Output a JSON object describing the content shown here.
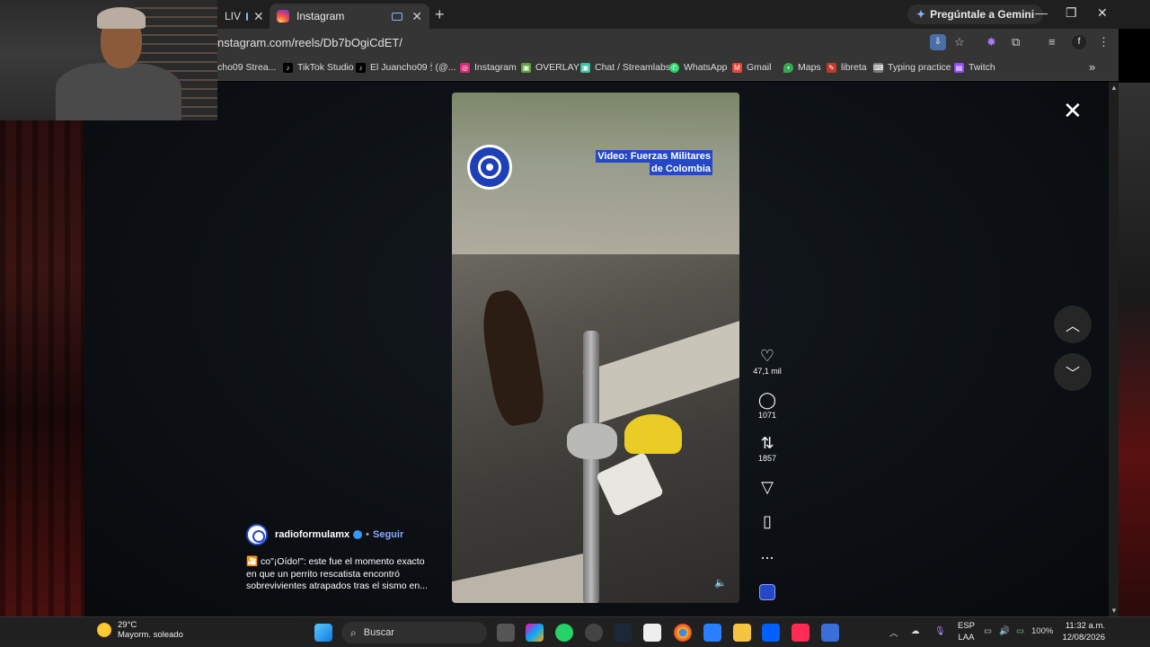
{
  "browser": {
    "tabs": [
      {
        "label": "LIV",
        "active": false
      },
      {
        "label": "Instagram",
        "active": true
      }
    ],
    "new_tab": "+",
    "gemini_label": "Pregúntale a Gemini",
    "url": "nstagram.com/reels/Db7bOgiCdET/",
    "window_controls": {
      "minimize": "—",
      "maximize": "❐",
      "close": "✕"
    },
    "bookmarks": [
      {
        "label": "cho09 Strea..."
      },
      {
        "label": "TikTok Studio"
      },
      {
        "label": "El Juancho09 🕯 (@..."
      },
      {
        "label": "Instagram"
      },
      {
        "label": "OVERLAY"
      },
      {
        "label": "Chat / Streamlabs"
      },
      {
        "label": "WhatsApp"
      },
      {
        "label": "Gmail"
      },
      {
        "label": "Maps"
      },
      {
        "label": "libreta"
      },
      {
        "label": "Typing practice"
      },
      {
        "label": "Twitch"
      }
    ],
    "bookmarks_more": "»"
  },
  "reel": {
    "video_caption_line1": "Video: Fuerzas Militares",
    "video_caption_line2": "de Colombia",
    "author": "radioformulamx",
    "follow_label": "Seguir",
    "separator": "•",
    "description": "🎦 co\"¡Oído!\": este fue el momento exacto en que un perrito rescatista encontró sobrevivientes atrapados tras el sismo en...",
    "likes": "47,1 mil",
    "comments": "1071",
    "reposts": "1857",
    "more": "...",
    "close_label": "✕",
    "prev_label": "︿",
    "next_label": "﹀"
  },
  "taskbar": {
    "weather_temp": "29°C",
    "weather_desc": "Mayorm. soleado",
    "search_placeholder": "Buscar",
    "lang_top": "ESP",
    "lang_bottom": "LAA",
    "battery": "100%",
    "time": "11:32 a.m.",
    "date": "12/08/2026"
  },
  "colors": {
    "accent": "#2548c6",
    "follow": "#8aa8ff",
    "bg": "#0c1014",
    "taskbar": "#202020"
  }
}
